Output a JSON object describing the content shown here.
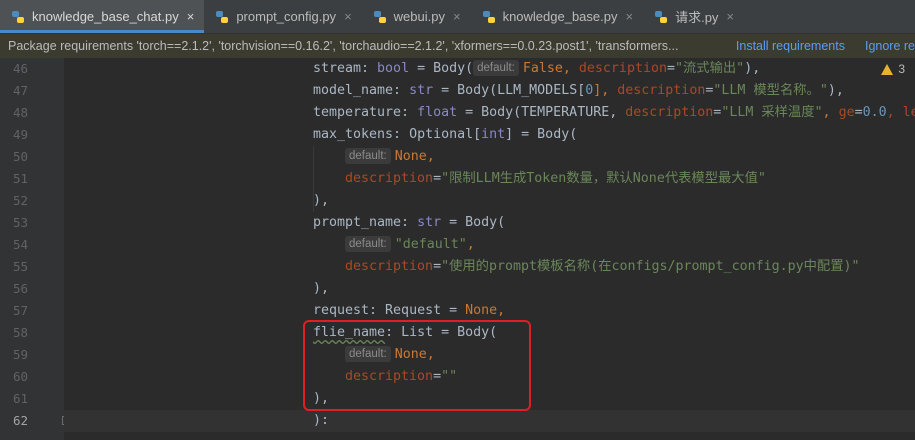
{
  "tabs": [
    {
      "label": "knowledge_base_chat.py",
      "active": true
    },
    {
      "label": "prompt_config.py",
      "active": false
    },
    {
      "label": "webui.py",
      "active": false
    },
    {
      "label": "knowledge_base.py",
      "active": false
    },
    {
      "label": "请求.py",
      "active": false
    }
  ],
  "close_glyph": "×",
  "notice": {
    "message": "Package requirements 'torch==2.1.2', 'torchvision==0.16.2', 'torchaudio==2.1.2', 'xformers==0.0.23.post1', 'transformers...",
    "install_label": "Install requirements",
    "ignore_label": "Ignore re"
  },
  "warnings": {
    "count": "3"
  },
  "line_numbers": [
    "46",
    "47",
    "48",
    "49",
    "50",
    "51",
    "52",
    "53",
    "54",
    "55",
    "56",
    "57",
    "58",
    "59",
    "60",
    "61",
    "62"
  ],
  "code": {
    "l46": {
      "p1": "stream: ",
      "t1": "bool",
      "p2": " = Body(",
      "hint": "default:",
      "v1": "False",
      "p3": ", ",
      "k1": "description",
      "p4": "=",
      "s1": "\"流式输出\"",
      "p5": "),"
    },
    "l47": {
      "p1": "model_name: ",
      "t1": "str",
      "p2": " = Body(LLM_MODELS[",
      "n1": "0",
      "p3": "], ",
      "k1": "description",
      "p4": "=",
      "s1": "\"LLM 模型名称。\"",
      "p5": "),"
    },
    "l48": {
      "p1": "temperature: ",
      "t1": "float",
      "p2": " = Body(TEMPERATURE, ",
      "k1": "description",
      "p3": "=",
      "s1": "\"LLM 采样温度\"",
      "p4": ", ",
      "k2": "ge",
      "p5": "=",
      "n1": "0.0",
      "p6": ", le"
    },
    "l49": {
      "p1": "max_tokens: Optional[",
      "t1": "int",
      "p2": "] = Body("
    },
    "l50": {
      "hint": "default:",
      "v1": "None",
      "p1": ","
    },
    "l51": {
      "k1": "description",
      "p1": "=",
      "s1": "\"限制LLM生成Token数量，默认None代表模型最大值\""
    },
    "l52": {
      "p1": "),"
    },
    "l53": {
      "p1": "prompt_name: ",
      "t1": "str",
      "p2": " = Body("
    },
    "l54": {
      "hint": "default:",
      "s1": "\"default\"",
      "p1": ","
    },
    "l55": {
      "k1": "description",
      "p1": "=",
      "s1": "\"使用的prompt模板名称(在configs/prompt_config.py中配置)\""
    },
    "l56": {
      "p1": "),"
    },
    "l57": {
      "p1": "request: Request = ",
      "v1": "None",
      "p2": ","
    },
    "l58": {
      "w1": "flie_name",
      "p1": ": List = Body("
    },
    "l59": {
      "hint": "default:",
      "v1": "None",
      "p1": ","
    },
    "l60": {
      "k1": "description",
      "p1": "=",
      "s1": "\"\""
    },
    "l61": {
      "p1": "),"
    },
    "l62": {
      "p1": "):"
    }
  }
}
